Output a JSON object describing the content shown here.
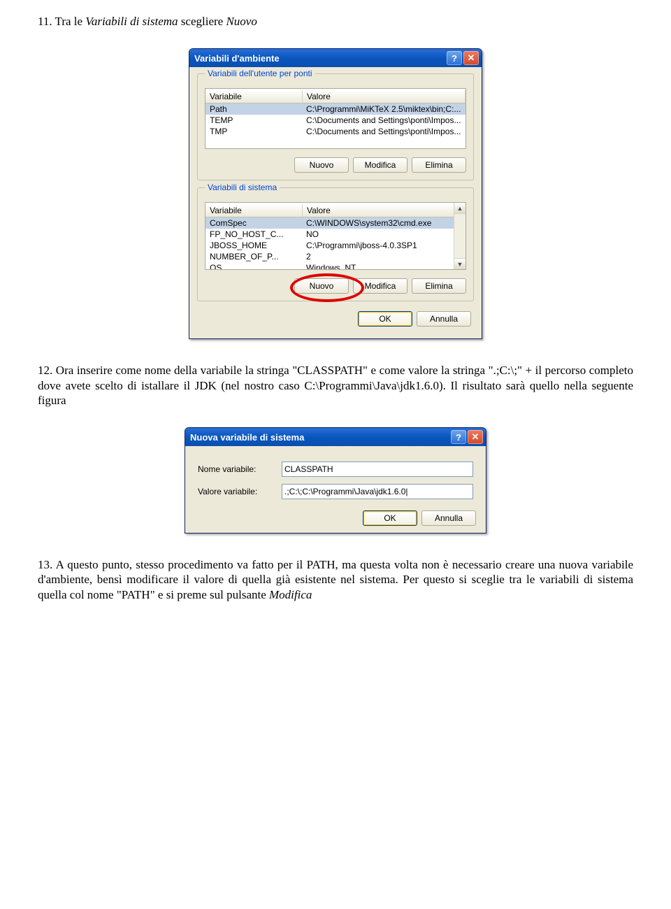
{
  "doc": {
    "p1_prefix": "11. Tra le ",
    "p1_em1": "Variabili di sistema",
    "p1_mid": " scegliere ",
    "p1_em2": "Nuovo",
    "p2": "12. Ora inserire come nome della variabile la stringa \"CLASSPATH\" e come valore la stringa \".;C:\\;\" +  il percorso completo dove avete scelto di istallare il JDK (nel nostro caso C:\\Programmi\\Java\\jdk1.6.0). Il risultato sarà quello nella seguente figura",
    "p3_a": "13. A questo punto, stesso procedimento va fatto per il PATH, ma questa volta non è necessario creare una nuova variabile d'ambiente, bensì modificare il valore di quella già esistente nel sistema. Per questo si sceglie tra le variabili di sistema quella col nome \"PATH\" e si preme sul pulsante ",
    "p3_em": "Modifica"
  },
  "dlg1": {
    "title": "Variabili d'ambiente",
    "group1": "Variabili dell'utente per ponti",
    "group2": "Variabili di sistema",
    "col_var": "Variabile",
    "col_val": "Valore",
    "user_rows": [
      {
        "v": "Path",
        "val": "C:\\Programmi\\MiKTeX 2.5\\miktex\\bin;C:..."
      },
      {
        "v": "TEMP",
        "val": "C:\\Documents and Settings\\ponti\\Impos..."
      },
      {
        "v": "TMP",
        "val": "C:\\Documents and Settings\\ponti\\Impos..."
      }
    ],
    "sys_rows": [
      {
        "v": "ComSpec",
        "val": "C:\\WINDOWS\\system32\\cmd.exe"
      },
      {
        "v": "FP_NO_HOST_C...",
        "val": "NO"
      },
      {
        "v": "JBOSS_HOME",
        "val": "C:\\Programmi\\jboss-4.0.3SP1"
      },
      {
        "v": "NUMBER_OF_P...",
        "val": "2"
      },
      {
        "v": "OS",
        "val": "Windows_NT"
      }
    ],
    "btn_new": "Nuovo",
    "btn_mod": "Modifica",
    "btn_del": "Elimina",
    "btn_ok": "OK",
    "btn_cancel": "Annulla"
  },
  "dlg2": {
    "title": "Nuova variabile di sistema",
    "lbl_name": "Nome variabile:",
    "lbl_val": "Valore variabile:",
    "val_name": "CLASSPATH",
    "val_val": ".;C:\\;C:\\Programmi\\Java\\jdk1.6.0|",
    "btn_ok": "OK",
    "btn_cancel": "Annulla"
  },
  "icons": {
    "help": "?",
    "close": "✕",
    "up": "▲",
    "down": "▼"
  }
}
